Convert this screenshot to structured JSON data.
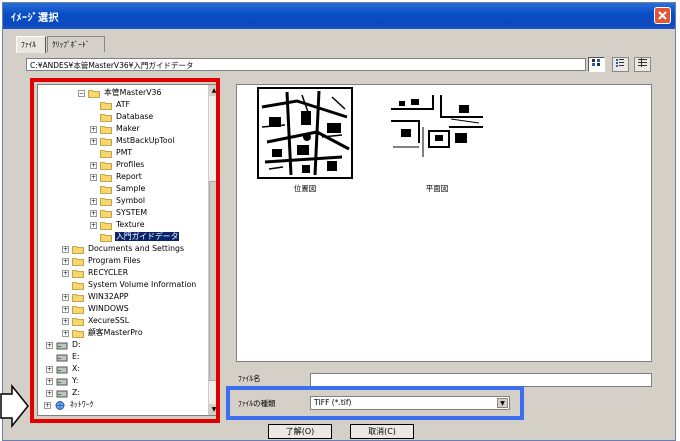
{
  "window": {
    "title": "ｲﾒｰｼﾞ選択"
  },
  "tabs": [
    {
      "label": "ﾌｧｲﾙ",
      "active": true
    },
    {
      "label": "ｸﾘｯﾌﾟﾎﾞｰﾄﾞ",
      "active": false
    }
  ],
  "path": "C:¥ANDES¥本管MasterV36¥入門ガイドデータ",
  "view_buttons": [
    "large-icons",
    "small-icons",
    "details"
  ],
  "tree": {
    "items": [
      {
        "label": "本管MasterV36",
        "level": 0,
        "expander": "⊟",
        "icon": "folder-open"
      },
      {
        "label": "ATF",
        "level": 1,
        "expander": "",
        "icon": "folder"
      },
      {
        "label": "Database",
        "level": 1,
        "expander": "",
        "icon": "folder"
      },
      {
        "label": "Maker",
        "level": 1,
        "expander": "+",
        "icon": "folder"
      },
      {
        "label": "MstBackUpTool",
        "level": 1,
        "expander": "+",
        "icon": "folder"
      },
      {
        "label": "PMT",
        "level": 1,
        "expander": "",
        "icon": "folder"
      },
      {
        "label": "Profiles",
        "level": 1,
        "expander": "+",
        "icon": "folder"
      },
      {
        "label": "Report",
        "level": 1,
        "expander": "+",
        "icon": "folder"
      },
      {
        "label": "Sample",
        "level": 1,
        "expander": "",
        "icon": "folder"
      },
      {
        "label": "Symbol",
        "level": 1,
        "expander": "+",
        "icon": "folder"
      },
      {
        "label": "SYSTEM",
        "level": 1,
        "expander": "+",
        "icon": "folder"
      },
      {
        "label": "Texture",
        "level": 1,
        "expander": "+",
        "icon": "folder"
      },
      {
        "label": "入門ガイドデータ",
        "level": 1,
        "expander": "",
        "icon": "folder-open",
        "selected": true
      },
      {
        "label": "Documents and Settings",
        "level": -1,
        "expander": "+",
        "icon": "folder"
      },
      {
        "label": "Program Files",
        "level": -1,
        "expander": "+",
        "icon": "folder"
      },
      {
        "label": "RECYCLER",
        "level": -1,
        "expander": "+",
        "icon": "folder"
      },
      {
        "label": "System Volume Information",
        "level": -1,
        "expander": "",
        "icon": "folder"
      },
      {
        "label": "WIN32APP",
        "level": -1,
        "expander": "+",
        "icon": "folder"
      },
      {
        "label": "WINDOWS",
        "level": -1,
        "expander": "+",
        "icon": "folder"
      },
      {
        "label": "XecureSSL",
        "level": -1,
        "expander": "+",
        "icon": "folder"
      },
      {
        "label": "顧客MasterPro",
        "level": -1,
        "expander": "+",
        "icon": "folder"
      },
      {
        "label": "D:",
        "level": -2,
        "expander": "+",
        "icon": "drive"
      },
      {
        "label": "E:",
        "level": -2,
        "expander": "",
        "icon": "drive"
      },
      {
        "label": "X:",
        "level": -2,
        "expander": "+",
        "icon": "drive"
      },
      {
        "label": "Y:",
        "level": -2,
        "expander": "+",
        "icon": "drive"
      },
      {
        "label": "Z:",
        "level": -2,
        "expander": "+",
        "icon": "drive"
      },
      {
        "label": "ﾈｯﾄﾜｰｸ",
        "level": -3,
        "expander": "+",
        "icon": "network"
      }
    ]
  },
  "thumbnails": [
    {
      "label": "位置図"
    },
    {
      "label": "平面図"
    }
  ],
  "filename": {
    "label": "ﾌｧｲﾙ名",
    "value": ""
  },
  "filetype": {
    "label": "ﾌｧｲﾙの種類",
    "value": "TIFF (*.tif)"
  },
  "buttons": {
    "ok": "了解(O)",
    "cancel": "取消(C)"
  },
  "colors": {
    "red_highlight": "#e00000",
    "blue_highlight": "#3b6ef0",
    "title_bar": "#0b49bd",
    "selection": "#0a246a"
  }
}
